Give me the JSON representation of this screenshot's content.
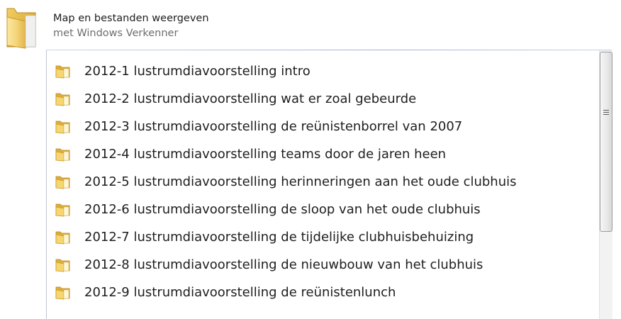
{
  "header": {
    "title": "Map en bestanden weergeven",
    "subtitle": "met Windows Verkenner",
    "icon": "folder-icon"
  },
  "list": {
    "icon": "folder-icon",
    "items": [
      {
        "label": "2012-1 lustrumdiavoorstelling intro"
      },
      {
        "label": "2012-2 lustrumdiavoorstelling wat er zoal gebeurde"
      },
      {
        "label": "2012-3 lustrumdiavoorstelling de reünistenborrel van 2007"
      },
      {
        "label": "2012-4 lustrumdiavoorstelling teams door de jaren heen"
      },
      {
        "label": "2012-5 lustrumdiavoorstelling herinneringen aan het oude clubhuis"
      },
      {
        "label": "2012-6 lustrumdiavoorstelling de sloop van het oude clubhuis"
      },
      {
        "label": "2012-7 lustrumdiavoorstelling de tijdelijke clubhuisbehuizing"
      },
      {
        "label": "2012-8 lustrumdiavoorstelling de nieuwbouw van het clubhuis"
      },
      {
        "label": "2012-9 lustrumdiavoorstelling de reünistenlunch"
      }
    ]
  },
  "colors": {
    "text": "#1e1e1e",
    "subtext": "#6d6d6d",
    "folder_light": "#f7d774",
    "folder_dark": "#d9a72c",
    "separator": "#98b4d8"
  },
  "scrollbar": {
    "position_fraction": 0.0,
    "visible_fraction": 0.65
  }
}
